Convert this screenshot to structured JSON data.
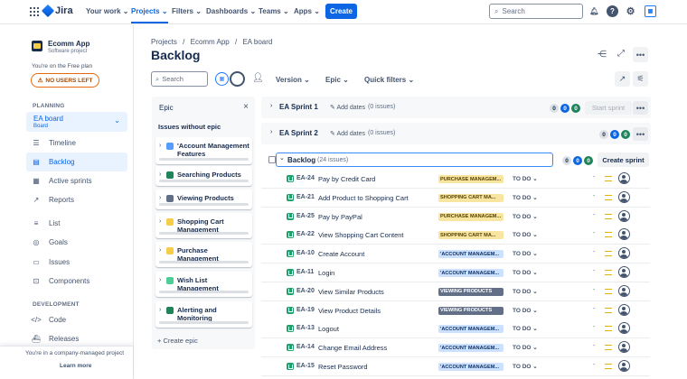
{
  "nav": {
    "product": "Jira",
    "your_work": "Your work",
    "projects": "Projects",
    "filters": "Filters",
    "dashboards": "Dashboards",
    "teams": "Teams",
    "apps": "Apps",
    "create": "Create",
    "search_placeholder": "Search"
  },
  "sidebar": {
    "project_name": "Ecomm App",
    "project_type": "Software project",
    "plan_note": "You're on the Free plan",
    "no_users_left": "NO USERS LEFT",
    "planning_label": "PLANNING",
    "board_name": "EA board",
    "board_sub": "Board",
    "planning_items": [
      {
        "label": "Timeline"
      },
      {
        "label": "Backlog"
      },
      {
        "label": "Active sprints"
      },
      {
        "label": "Reports"
      }
    ],
    "other_items": [
      {
        "label": "List"
      },
      {
        "label": "Goals"
      },
      {
        "label": "Issues"
      },
      {
        "label": "Components"
      }
    ],
    "development_label": "DEVELOPMENT",
    "dev_items": [
      {
        "label": "Code"
      },
      {
        "label": "Releases"
      }
    ],
    "footer_note": "You're in a company-managed project",
    "learn_more": "Learn more"
  },
  "main": {
    "breadcrumbs": [
      "Projects",
      "Ecomm App",
      "EA board"
    ],
    "title": "Backlog",
    "search_placeholder": "Search",
    "filters": {
      "version": "Version",
      "epic": "Epic",
      "quick_filters": "Quick filters"
    }
  },
  "epic_panel": {
    "title": "Epic",
    "issues_without_epic": "Issues without epic",
    "epics": [
      {
        "name": "'Account Management Features",
        "color": "#579dff"
      },
      {
        "name": "Searching Products",
        "color": "#1f845a"
      },
      {
        "name": "Viewing Products",
        "color": "#626f86"
      },
      {
        "name": "Shopping Cart Management",
        "color": "#f5cd47"
      },
      {
        "name": "Purchase Management",
        "color": "#f5cd47"
      },
      {
        "name": "Wish List Management",
        "color": "#4bce97"
      },
      {
        "name": "Alerting and Monitoring",
        "color": "#1f845a"
      }
    ],
    "create_epic": "+ Create epic"
  },
  "sprints": [
    {
      "name": "EA Sprint 1",
      "add_dates": "Add dates",
      "count": "(0 issues)",
      "todo": "0",
      "inprog": "0",
      "done": "0",
      "button": "Start sprint"
    },
    {
      "name": "EA Sprint 2",
      "add_dates": "Add dates",
      "count": "(0 issues)",
      "todo": "0",
      "inprog": "0",
      "done": "0"
    }
  ],
  "backlog": {
    "name": "Backlog",
    "count": "(24 issues)",
    "todo": "0",
    "inprog": "0",
    "done": "0",
    "create_sprint": "Create sprint",
    "issues": [
      {
        "key": "EA-24",
        "title": "Pay by Credit Card",
        "epic": "PURCHASE MANAGEM...",
        "epic_bg": "#f8e6a0",
        "epic_fg": "#533f04",
        "status": "TO DO",
        "est": "-"
      },
      {
        "key": "EA-21",
        "title": "Add Product to Shopping Cart",
        "epic": "SHOPPING CART MA...",
        "epic_bg": "#f8e6a0",
        "epic_fg": "#533f04",
        "status": "TO DO",
        "est": "-"
      },
      {
        "key": "EA-25",
        "title": "Pay by PayPal",
        "epic": "PURCHASE MANAGEM...",
        "epic_bg": "#f8e6a0",
        "epic_fg": "#533f04",
        "status": "TO DO",
        "est": "-"
      },
      {
        "key": "EA-22",
        "title": "View Shopping Cart Content",
        "epic": "SHOPPING CART MA...",
        "epic_bg": "#f8e6a0",
        "epic_fg": "#533f04",
        "status": "TO DO",
        "est": "-"
      },
      {
        "key": "EA-10",
        "title": "Create Account",
        "epic": "'ACCOUNT MANAGEM...",
        "epic_bg": "#cce0ff",
        "epic_fg": "#09326c",
        "status": "TO DO",
        "est": "-"
      },
      {
        "key": "EA-11",
        "title": "Login",
        "epic": "'ACCOUNT MANAGEM...",
        "epic_bg": "#cce0ff",
        "epic_fg": "#09326c",
        "status": "TO DO",
        "est": "-"
      },
      {
        "key": "EA-20",
        "title": "View Similar Products",
        "epic": "VIEWING PRODUCTS",
        "epic_bg": "#626f86",
        "epic_fg": "#ffffff",
        "status": "TO DO",
        "est": "-"
      },
      {
        "key": "EA-19",
        "title": "View Product Details",
        "epic": "VIEWING PRODUCTS",
        "epic_bg": "#626f86",
        "epic_fg": "#ffffff",
        "status": "TO DO",
        "est": "-"
      },
      {
        "key": "EA-13",
        "title": "Logout",
        "epic": "'ACCOUNT MANAGEM...",
        "epic_bg": "#cce0ff",
        "epic_fg": "#09326c",
        "status": "TO DO",
        "est": "-"
      },
      {
        "key": "EA-14",
        "title": "Change Email Address",
        "epic": "'ACCOUNT MANAGEM...",
        "epic_bg": "#cce0ff",
        "epic_fg": "#09326c",
        "status": "TO DO",
        "est": "-"
      },
      {
        "key": "EA-15",
        "title": "Reset Password",
        "epic": "'ACCOUNT MANAGEM...",
        "epic_bg": "#cce0ff",
        "epic_fg": "#09326c",
        "status": "TO DO",
        "est": "-"
      }
    ]
  }
}
